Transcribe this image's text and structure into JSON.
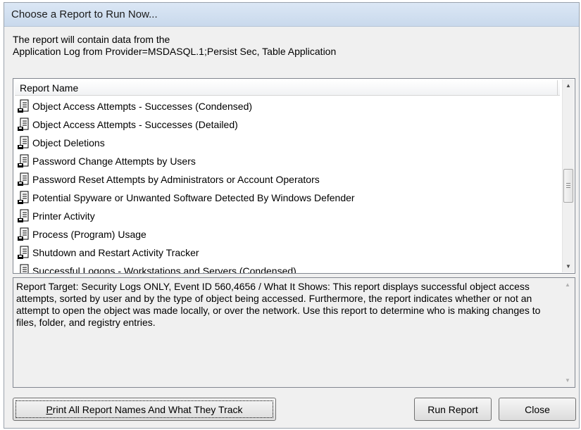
{
  "window": {
    "title": "Choose a Report to Run Now..."
  },
  "intro": {
    "line1": "The report will contain data from the",
    "line2": "Application Log from Provider=MSDASQL.1;Persist Sec, Table Application"
  },
  "report_list": {
    "column_header": "Report Name",
    "icon": "report-document-icon",
    "items": [
      {
        "label": "Object Access Attempts - Successes (Condensed)"
      },
      {
        "label": "Object Access Attempts - Successes (Detailed)"
      },
      {
        "label": "Object Deletions"
      },
      {
        "label": "Password Change Attempts by Users"
      },
      {
        "label": "Password Reset Attempts by Administrators or Account Operators"
      },
      {
        "label": "Potential Spyware or Unwanted Software Detected By Windows Defender"
      },
      {
        "label": "Printer Activity"
      },
      {
        "label": "Process (Program) Usage"
      },
      {
        "label": "Shutdown and Restart Activity Tracker"
      },
      {
        "label": "Successful Logons - Workstations and Servers (Condensed)"
      }
    ]
  },
  "description": {
    "text": "Report Target: Security Logs ONLY, Event ID 560,4656 / What It Shows: This report displays successful object access attempts, sorted by user and by the type of object being accessed.  Furthermore, the report indicates whether or not an attempt to open the object was made locally, or over the network.  Use this report to determine who is making changes to files, folder, and registry entries."
  },
  "buttons": {
    "print_mnemonic": "P",
    "print_rest": "rint All Report Names And What They Track",
    "run": "Run Report",
    "close": "Close"
  }
}
